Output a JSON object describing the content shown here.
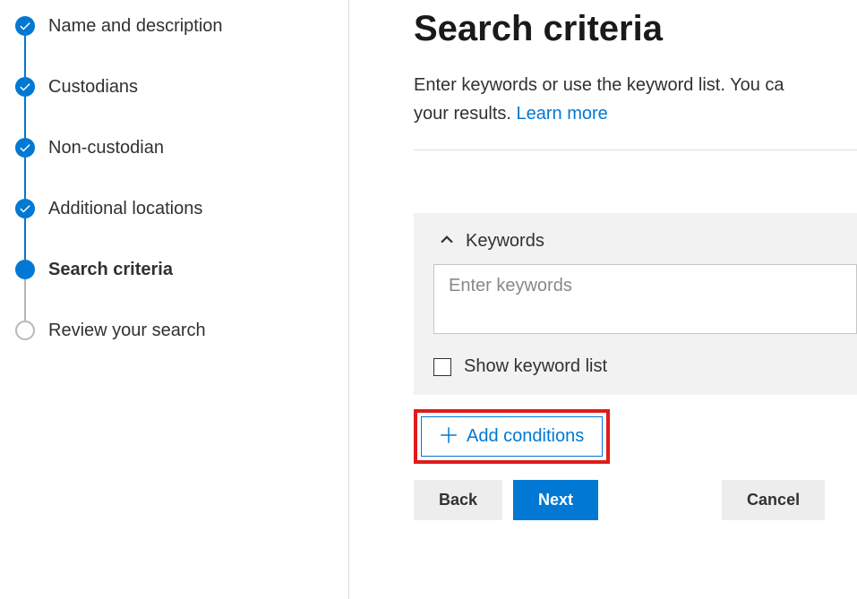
{
  "wizard": {
    "steps": [
      {
        "label": "Name and description",
        "state": "done"
      },
      {
        "label": "Custodians",
        "state": "done"
      },
      {
        "label": "Non-custodian",
        "state": "done"
      },
      {
        "label": "Additional locations",
        "state": "done"
      },
      {
        "label": "Search criteria",
        "state": "active"
      },
      {
        "label": "Review your search",
        "state": "pending"
      }
    ]
  },
  "main": {
    "title": "Search criteria",
    "description_prefix": "Enter keywords or use the keyword list. You ca",
    "description_suffix": "your results. ",
    "learn_more": "Learn more",
    "keywords": {
      "section_label": "Keywords",
      "placeholder": "Enter keywords",
      "show_list_label": "Show keyword list"
    },
    "add_conditions": "Add conditions",
    "buttons": {
      "back": "Back",
      "next": "Next",
      "cancel": "Cancel"
    }
  }
}
